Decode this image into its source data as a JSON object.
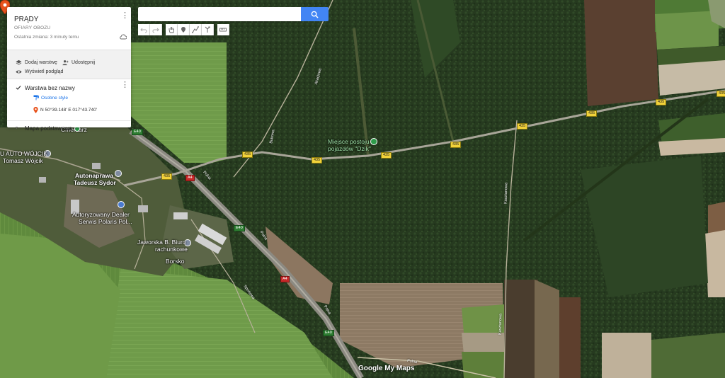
{
  "map_title": "PRĄDY",
  "map_subtitle": "OFIARY OBOZU",
  "last_changed": "Ostatnia zmiana: 3 minuty temu",
  "actions": {
    "add_layer": "Dodaj warstwę",
    "share": "Udostępnij",
    "preview": "Wyświetl podgląd"
  },
  "layer": {
    "name": "Warstwa bez nazwy",
    "style_link": "Osobne style",
    "item_coord": "N 50°39.148' E 017°43.740'"
  },
  "basemap_label": "Mapa podstawowa",
  "search": {
    "value": "",
    "placeholder": ""
  },
  "toolbar": [
    "undo-icon",
    "redo-icon",
    "hand-icon",
    "marker-icon",
    "draw-line-icon",
    "directions-icon",
    "ruler-icon"
  ],
  "map_labels": {
    "cemetery": "Cmentarz",
    "auto_wojcik_1": "U AUTO WÓJCIK",
    "auto_wojcik_2": "Tomasz Wójcik",
    "autonaprawa_1": "Autonaprawa",
    "autonaprawa_2": "Tadeusz Sydor",
    "polaris_1": "Autoryzowany Dealer",
    "polaris_2": "Serwis Polaris Pol...",
    "jaworska_1": "Jaworska B. Biuro",
    "jaworska_2": "rachunkowe",
    "borsko": "Borsko",
    "parking_1": "Miejsce postoju",
    "parking_2": "pojazdów \"Dzik\"",
    "logo": "Google My Maps"
  },
  "road_labels": {
    "akacjowa": "Akacjowa",
    "kasztanowa_1": "Kasztanowa",
    "kasztanowa_2": "Kasztanowa",
    "polna_1": "Polna",
    "polna_2": "Polna",
    "polna_3": "Polna",
    "polna_4": "Polna",
    "sportowa": "Sportowa",
    "bukowa": "Bukowa"
  },
  "shields": {
    "r435": "435",
    "a4": "A4",
    "e40": "E40"
  },
  "colors": {
    "accent": "#4285f4",
    "pin": "#e8541e",
    "link": "#1a73e8"
  }
}
